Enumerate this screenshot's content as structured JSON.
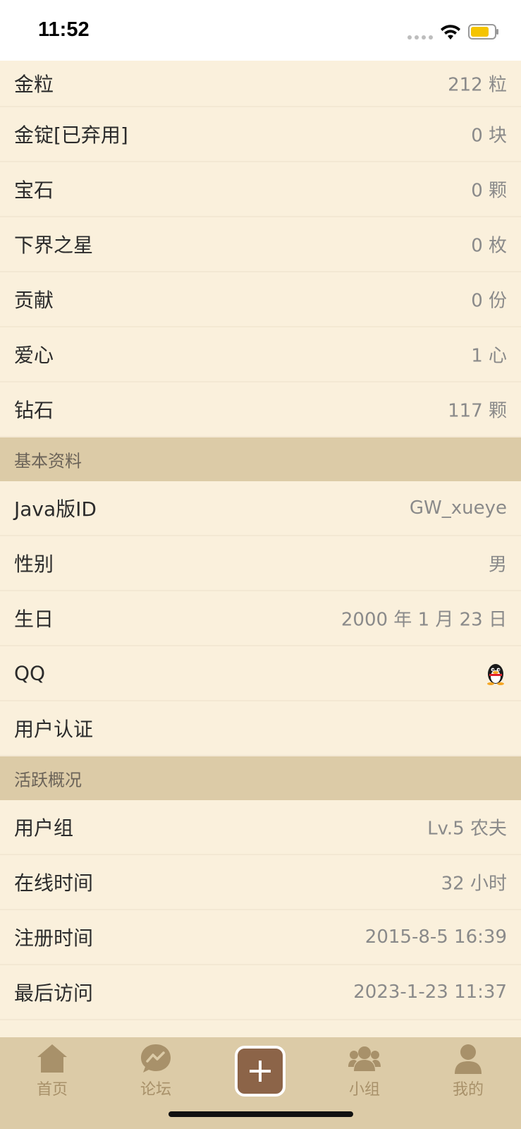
{
  "status_bar": {
    "time": "11:52"
  },
  "rows_top": [
    {
      "label": "金粒",
      "value": "212 粒"
    },
    {
      "label": "金锭[已弃用]",
      "value": "0 块"
    },
    {
      "label": "宝石",
      "value": "0 颗"
    },
    {
      "label": "下界之星",
      "value": "0 枚"
    },
    {
      "label": "贡献",
      "value": "0 份"
    },
    {
      "label": "爱心",
      "value": "1 心"
    },
    {
      "label": "钻石",
      "value": "117 颗"
    }
  ],
  "section_basic": {
    "title": "基本资料",
    "rows": [
      {
        "label": "Java版ID",
        "value": "GW_xueye"
      },
      {
        "label": "性别",
        "value": "男"
      },
      {
        "label": "生日",
        "value": "2000 年 1 月 23 日"
      },
      {
        "label": "QQ",
        "icon": "qq-penguin-icon"
      },
      {
        "label": "用户认证",
        "value": ""
      }
    ]
  },
  "section_activity": {
    "title": "活跃概况",
    "rows": [
      {
        "label": "用户组",
        "value": "Lv.5 农夫"
      },
      {
        "label": "在线时间",
        "value": "32 小时"
      },
      {
        "label": "注册时间",
        "value": "2015-8-5 16:39"
      },
      {
        "label": "最后访问",
        "value": "2023-1-23 11:37"
      }
    ]
  },
  "tab_bar": {
    "home": {
      "label": "首页",
      "icon": "home-icon"
    },
    "forum": {
      "label": "论坛",
      "icon": "forum-bubble-icon"
    },
    "post": {
      "icon": "plus-icon"
    },
    "group": {
      "label": "小组",
      "icon": "group-icon"
    },
    "mine": {
      "label": "我的",
      "icon": "person-icon"
    }
  },
  "colors": {
    "background": "#faf0dc",
    "section_header": "#dccba7",
    "tab_bar": "#dccba7",
    "tab_icon": "#a8916a",
    "post_button": "#8c6448",
    "value_text": "#8a8a8a"
  }
}
